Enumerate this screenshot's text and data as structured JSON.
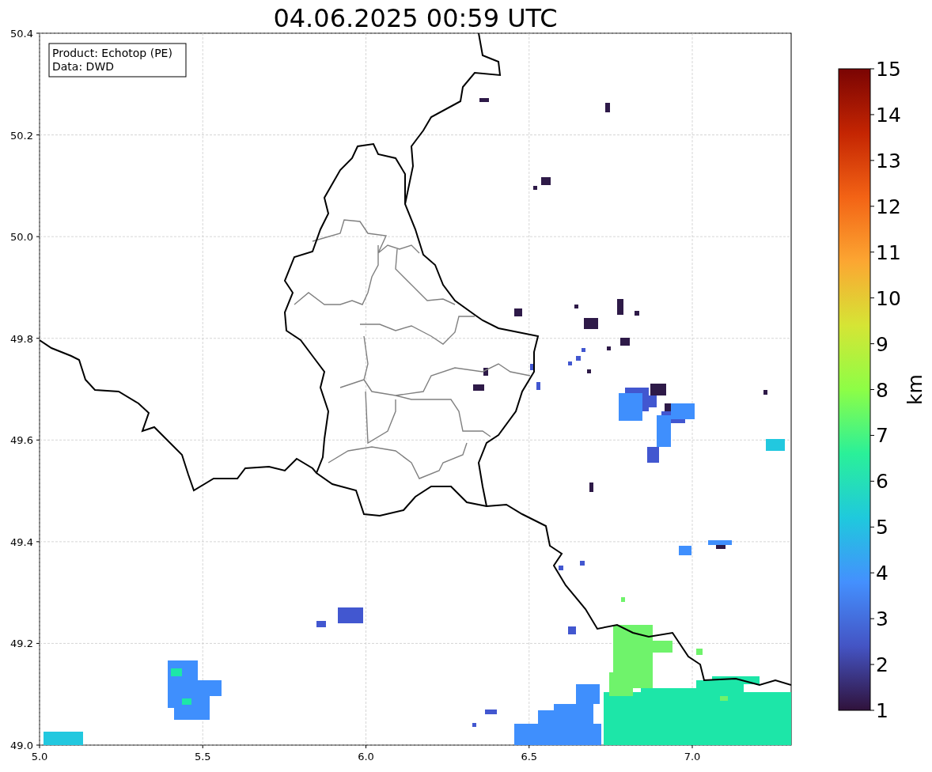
{
  "title": "04.06.2025 00:59 UTC",
  "info_box": [
    "Product: Echotop (PE)",
    "Data: DWD"
  ],
  "x_ticks": [
    "5.0",
    "5.5",
    "6.0",
    "6.5",
    "7.0"
  ],
  "y_ticks": [
    "50.4",
    "50.2",
    "50.0",
    "49.8",
    "49.6",
    "49.4",
    "49.2",
    "49.0"
  ],
  "colorbar": {
    "ticks": [
      "15",
      "14",
      "13",
      "12",
      "11",
      "10",
      "9",
      "8",
      "7",
      "6",
      "5",
      "4",
      "3",
      "2",
      "1"
    ],
    "label": "km"
  }
}
